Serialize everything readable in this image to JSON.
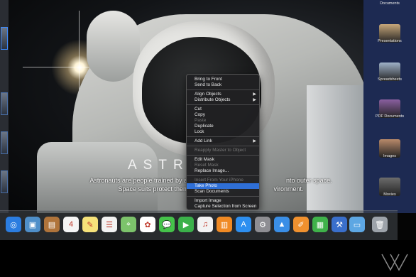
{
  "slide": {
    "title": "ASTRO",
    "body_line1": "Astronauts are people trained by a spacec",
    "body_line1_end": "nto outer space.",
    "body_line2": "Space suits protect them whi",
    "body_line2_end": "vironment."
  },
  "context_menu": {
    "items": [
      {
        "label": "Bring to Front",
        "enabled": true
      },
      {
        "label": "Send to Back",
        "enabled": true
      },
      {
        "separator": true
      },
      {
        "label": "Align Objects",
        "submenu": true,
        "enabled": true
      },
      {
        "label": "Distribute Objects",
        "submenu": true,
        "enabled": true
      },
      {
        "separator": true
      },
      {
        "label": "Cut",
        "enabled": true
      },
      {
        "label": "Copy",
        "enabled": true
      },
      {
        "label": "Paste",
        "enabled": false
      },
      {
        "label": "Duplicate",
        "enabled": true
      },
      {
        "label": "Lock",
        "enabled": true
      },
      {
        "separator": true
      },
      {
        "label": "Add Link",
        "submenu": true,
        "enabled": true
      },
      {
        "separator": true
      },
      {
        "label": "Reapply Master to Object",
        "enabled": false
      },
      {
        "separator": true
      },
      {
        "label": "Edit Mask",
        "enabled": true
      },
      {
        "label": "Reset Mask",
        "enabled": false
      },
      {
        "label": "Replace Image...",
        "enabled": true
      },
      {
        "separator": true
      },
      {
        "label": "Insert From Your iPhone",
        "enabled": false
      },
      {
        "label": "Take Photo",
        "enabled": true,
        "highlighted": true
      },
      {
        "label": "Scan Documents",
        "enabled": true
      },
      {
        "separator": true
      },
      {
        "label": "Import Image",
        "enabled": true
      },
      {
        "label": "Capture Selection from Screen",
        "enabled": true
      }
    ]
  },
  "media_browser": {
    "items": [
      {
        "label": "Documents",
        "color": "#7b8da8"
      },
      {
        "label": "Presentations",
        "color": "#c7a77a"
      },
      {
        "label": "Spreadsheets",
        "color": "#9fb2c8"
      },
      {
        "label": "PDF Documents",
        "color": "#8a5fa0"
      },
      {
        "label": "Images",
        "color": "#b98a6a"
      },
      {
        "label": "Movies",
        "color": "#6c6c6c"
      }
    ]
  },
  "dock": {
    "icons": [
      {
        "name": "safari-icon",
        "glyph": "◎",
        "color": "#2b7de0"
      },
      {
        "name": "preview-icon",
        "glyph": "▣",
        "color": "#4f8fc9"
      },
      {
        "name": "notebook-icon",
        "glyph": "▤",
        "color": "#b0743b"
      },
      {
        "name": "calendar-icon",
        "glyph": "4",
        "color": "#f5f5f5"
      },
      {
        "name": "notes-icon",
        "glyph": "✎",
        "color": "#f6e27a"
      },
      {
        "name": "reminders-icon",
        "glyph": "☰",
        "color": "#f2f2f2"
      },
      {
        "name": "maps-icon",
        "glyph": "⌖",
        "color": "#7cc36b"
      },
      {
        "name": "photos-icon",
        "glyph": "✿",
        "color": "#ffffff"
      },
      {
        "name": "messages-icon",
        "glyph": "💬",
        "color": "#45c24a"
      },
      {
        "name": "facetime-icon",
        "glyph": "▶",
        "color": "#3bb14a"
      },
      {
        "name": "music-icon",
        "glyph": "♫",
        "color": "#f2f2f2"
      },
      {
        "name": "books-icon",
        "glyph": "▥",
        "color": "#f08a24"
      },
      {
        "name": "app-store-icon",
        "glyph": "A",
        "color": "#2d8ff0"
      },
      {
        "name": "system-preferences-icon",
        "glyph": "⚙",
        "color": "#8e8e93"
      },
      {
        "name": "keynote-icon",
        "glyph": "▲",
        "color": "#3a8ee6"
      },
      {
        "name": "pages-icon",
        "glyph": "✐",
        "color": "#f0912f"
      },
      {
        "name": "numbers-icon",
        "glyph": "▦",
        "color": "#3fb24a"
      },
      {
        "name": "xcode-icon",
        "glyph": "⚒",
        "color": "#3a6fcb"
      },
      {
        "name": "folder-icon",
        "glyph": "▭",
        "color": "#5da7e3"
      },
      {
        "name": "trash-icon",
        "glyph": "🗑",
        "color": "#9da3aa"
      }
    ]
  }
}
